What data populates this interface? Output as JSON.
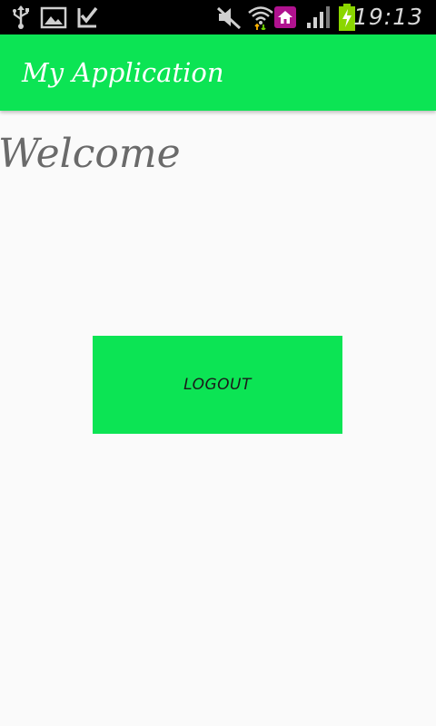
{
  "status_bar": {
    "time": "19:13",
    "icons": [
      "usb-icon",
      "gallery-icon",
      "download-done-icon",
      "muted-icon",
      "wifi-icon",
      "home-icon",
      "signal-icon",
      "battery-charging-icon"
    ]
  },
  "app_bar": {
    "title": "My Application"
  },
  "main": {
    "welcome_text": "Welcome",
    "logout_label": "LOGOUT"
  },
  "colors": {
    "accent": "#0ce454",
    "background": "#fafafa",
    "status_bar": "#000000",
    "title_text": "#ffffff",
    "welcome_text": "#6a6a6a"
  }
}
